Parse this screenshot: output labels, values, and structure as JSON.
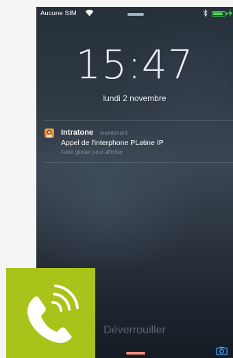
{
  "statusbar": {
    "carrier": "Aucune SIM",
    "battery_level": 0.9
  },
  "lockscreen": {
    "time": "15:47",
    "date": "lundi 2 novembre",
    "unlock_label": "Déverrouiller"
  },
  "notification": {
    "app_name": "Intratone",
    "time": "maintenant",
    "message": "Appel de l'interphone PLatine IP",
    "hint": "Faire glisser pour afficher"
  },
  "colors": {
    "tile_green": "#a9c31a",
    "battery_green": "#3ddc52",
    "app_orange": "#f09a37"
  },
  "icons": [
    "wifi-icon",
    "bluetooth-icon",
    "battery-icon",
    "charging-icon",
    "app-icon",
    "camera-icon",
    "phone-call-icon"
  ]
}
